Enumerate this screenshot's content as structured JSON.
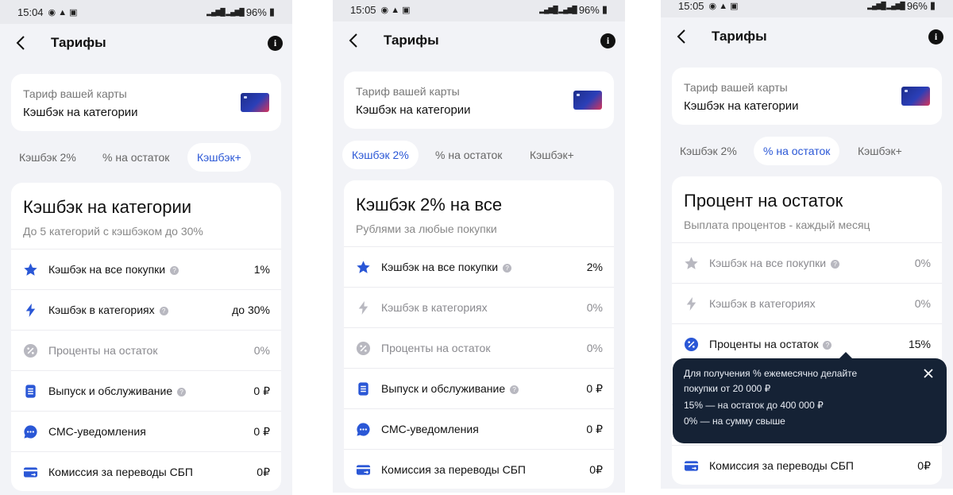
{
  "screens": [
    {
      "status": {
        "time": "15:04",
        "battery": "96%"
      },
      "header": {
        "title": "Тарифы"
      },
      "tariff": {
        "label": "Тариф вашей карты",
        "value": "Кэшбэк на категории"
      },
      "tabs": [
        "Кэшбэк 2%",
        "% на остаток",
        "Кэшбэк+"
      ],
      "active_tab": 2,
      "panel": {
        "title": "Кэшбэк на категории",
        "subtitle": "До 5 категорий с кэшбэком до 30%",
        "rows": [
          {
            "icon": "star-icon",
            "label": "Кэшбэк на все покупки",
            "value": "1%",
            "active": true,
            "help": true
          },
          {
            "icon": "lightning-icon",
            "label": "Кэшбэк в категориях",
            "value": "до 30%",
            "active": true,
            "help": true
          },
          {
            "icon": "percent-icon",
            "label": "Проценты на остаток",
            "value": "0%",
            "active": false,
            "help": false
          },
          {
            "icon": "document-icon",
            "label": "Выпуск и обслуживание",
            "value": "0 ₽",
            "active": true,
            "help": true
          },
          {
            "icon": "chat-icon",
            "label": "СМС-уведомления",
            "value": "0 ₽",
            "active": true,
            "help": false
          },
          {
            "icon": "card-transfer-icon",
            "label": "Комиссия за переводы СБП",
            "value": "0₽",
            "active": true,
            "help": false
          }
        ]
      }
    },
    {
      "status": {
        "time": "15:05",
        "battery": "96%"
      },
      "header": {
        "title": "Тарифы"
      },
      "tariff": {
        "label": "Тариф вашей карты",
        "value": "Кэшбэк на категории"
      },
      "tabs": [
        "Кэшбэк 2%",
        "% на остаток",
        "Кэшбэк+"
      ],
      "active_tab": 0,
      "panel": {
        "title": "Кэшбэк 2% на все",
        "subtitle": "Рублями за любые покупки",
        "rows": [
          {
            "icon": "star-icon",
            "label": "Кэшбэк на все покупки",
            "value": "2%",
            "active": true,
            "help": true
          },
          {
            "icon": "lightning-icon",
            "label": "Кэшбэк в категориях",
            "value": "0%",
            "active": false,
            "help": false
          },
          {
            "icon": "percent-icon",
            "label": "Проценты на остаток",
            "value": "0%",
            "active": false,
            "help": false
          },
          {
            "icon": "document-icon",
            "label": "Выпуск и обслуживание",
            "value": "0 ₽",
            "active": true,
            "help": true
          },
          {
            "icon": "chat-icon",
            "label": "СМС-уведомления",
            "value": "0 ₽",
            "active": true,
            "help": false
          },
          {
            "icon": "card-transfer-icon",
            "label": "Комиссия за переводы СБП",
            "value": "0₽",
            "active": true,
            "help": false
          }
        ]
      }
    },
    {
      "status": {
        "time": "15:05",
        "battery": "96%"
      },
      "header": {
        "title": "Тарифы"
      },
      "tariff": {
        "label": "Тариф вашей карты",
        "value": "Кэшбэк на категории"
      },
      "tabs": [
        "Кэшбэк 2%",
        "% на остаток",
        "Кэшбэк+"
      ],
      "active_tab": 1,
      "panel": {
        "title": "Процент на остаток",
        "subtitle": "Выплата процентов - каждый месяц",
        "rows": [
          {
            "icon": "star-icon",
            "label": "Кэшбэк на все покупки",
            "value": "0%",
            "active": false,
            "help": true
          },
          {
            "icon": "lightning-icon",
            "label": "Кэшбэк в категориях",
            "value": "0%",
            "active": false,
            "help": false
          },
          {
            "icon": "percent-icon",
            "label": "Проценты на остаток",
            "value": "15%",
            "active": true,
            "help": true
          },
          {
            "icon": "document-icon",
            "label": "",
            "value": "",
            "active": true,
            "help": false
          },
          {
            "icon": "chat-icon",
            "label": "",
            "value": "",
            "active": true,
            "help": false
          },
          {
            "icon": "card-transfer-icon",
            "label": "Комиссия за переводы СБП",
            "value": "0₽",
            "active": true,
            "help": false
          }
        ]
      },
      "tooltip": {
        "lines": [
          "Для получения % ежемесячно делайте",
          "покупки от 20 000 ₽",
          "15% — на остаток до 400 000 ₽",
          "0% — на сумму свыше"
        ]
      }
    }
  ],
  "colors": {
    "accent": "#2a57d6",
    "dim_icon": "#b8b8c0",
    "tooltip_bg": "#152235"
  }
}
